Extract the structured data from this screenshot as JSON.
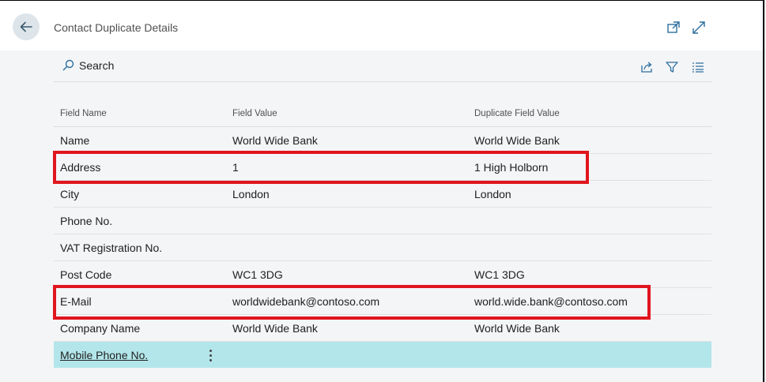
{
  "header": {
    "title": "Contact Duplicate Details",
    "back_icon": "arrow-left-icon",
    "open_new_window_icon": "open-in-new-window-icon",
    "expand_icon": "expand-icon"
  },
  "toolbar": {
    "search_label": "Search",
    "search_icon": "search-icon",
    "share_icon": "share-icon",
    "filter_icon": "filter-icon",
    "list_icon": "list-view-icon"
  },
  "table": {
    "columns": [
      "Field Name",
      "Field Value",
      "Duplicate Field Value"
    ],
    "rows": [
      {
        "field": "Name",
        "value": "World Wide Bank",
        "duplicate": "World Wide Bank"
      },
      {
        "field": "Address",
        "value": "1",
        "duplicate": "1 High Holborn"
      },
      {
        "field": "City",
        "value": "London",
        "duplicate": "London"
      },
      {
        "field": "Phone No.",
        "value": "",
        "duplicate": ""
      },
      {
        "field": "VAT Registration No.",
        "value": "",
        "duplicate": ""
      },
      {
        "field": "Post Code",
        "value": "WC1 3DG",
        "duplicate": "WC1 3DG"
      },
      {
        "field": "E-Mail",
        "value": "worldwidebank@contoso.com",
        "duplicate": "world.wide.bank@contoso.com"
      },
      {
        "field": "Company Name",
        "value": "World Wide Bank",
        "duplicate": "World Wide Bank"
      },
      {
        "field": "Mobile Phone No.",
        "value": "",
        "duplicate": ""
      }
    ],
    "selected_row": 8
  },
  "colors": {
    "highlight_border": "#e0151e",
    "selected_row": "#b3e6ea",
    "accent": "#2c6e9e"
  }
}
